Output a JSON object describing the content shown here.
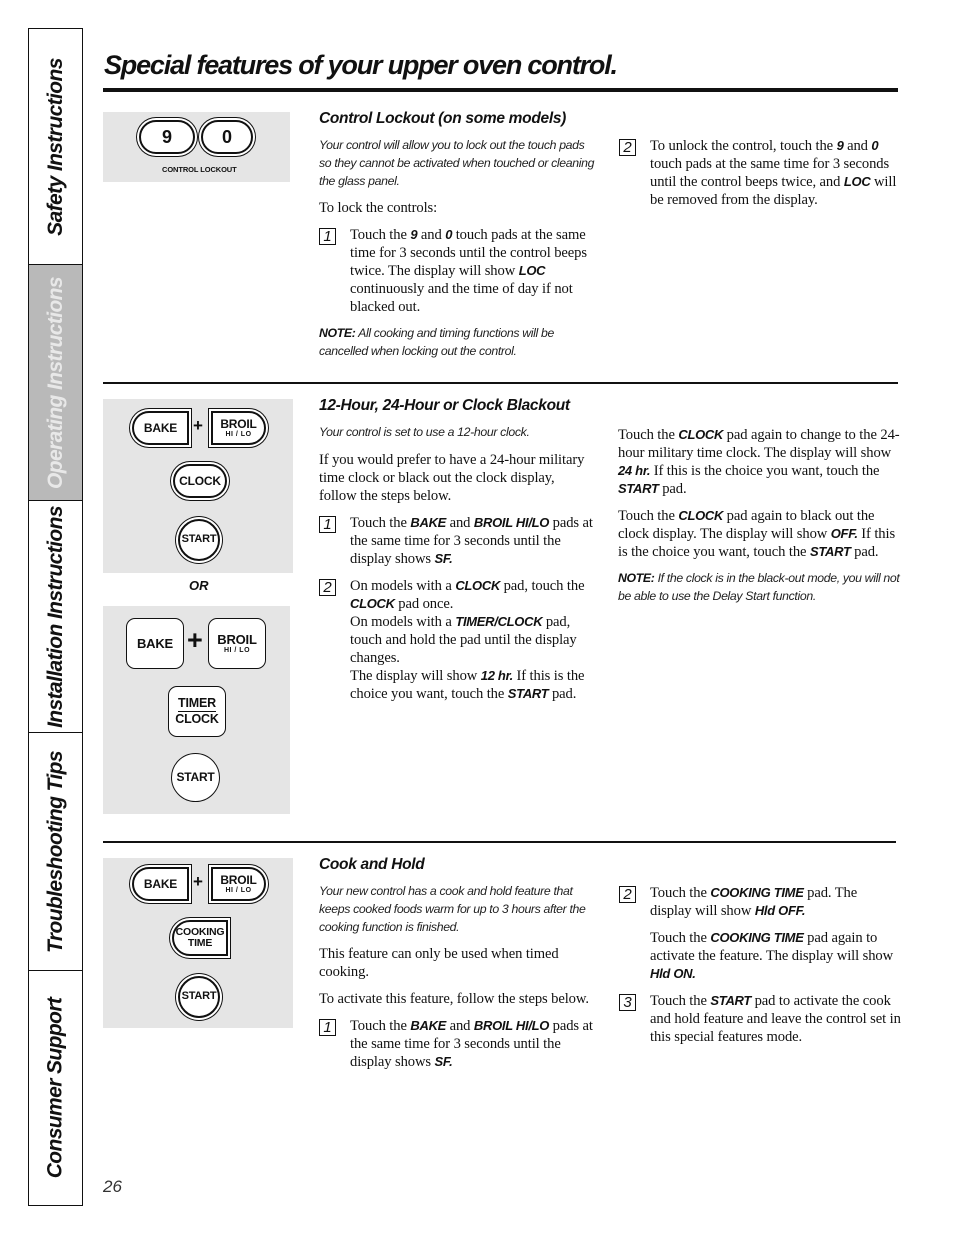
{
  "side_tabs": [
    {
      "label": "Safety Instructions",
      "active": false
    },
    {
      "label": "Operating Instructions",
      "active": true
    },
    {
      "label": "Installation Instructions",
      "active": false
    },
    {
      "label": "Troubleshooting Tips",
      "active": false
    },
    {
      "label": "Consumer Support",
      "active": false
    }
  ],
  "page_title": "Special features of your upper oven control.",
  "page_number": "26",
  "sections": {
    "lockout": {
      "heading": "Control Lockout (on some models)",
      "intro": "Your control will allow you to lock out the touch pads so they cannot be activated when touched or cleaning the glass panel.",
      "lead": "To lock the controls:",
      "pads": {
        "pad_9": "9",
        "pad_0": "0",
        "caption": "CONTROL LOCKOUT"
      },
      "step1": {
        "num": "1",
        "t1": "Touch the ",
        "k1": "9",
        "t2": " and ",
        "k2": "0",
        "t3": " touch pads at the same time for 3 seconds until the control beeps twice. The display will show ",
        "k3": "LOC",
        "t4": " continuously and the time of day if not blacked out."
      },
      "note": {
        "label": "NOTE:",
        "text": " All cooking and timing functions will be cancelled when locking out the control."
      },
      "step2": {
        "num": "2",
        "t1": "To unlock the control, touch the ",
        "k1": "9",
        "t2": " and ",
        "k2": "0",
        "t3": " touch pads at the same time for 3 seconds until the control beeps twice, and ",
        "k3": "LOC",
        "t4": " will be removed from the display."
      }
    },
    "clock": {
      "heading": "12-Hour, 24-Hour or Clock Blackout",
      "intro": "Your control is set to use a 12-hour clock.",
      "lead": "If you would prefer to have a 24-hour military time clock or black out the clock display, follow the steps below.",
      "panel_a": {
        "bake": "BAKE",
        "plus": "+",
        "broil": "BROIL",
        "broil_sub": "HI / LO",
        "clock": "CLOCK",
        "start": "START"
      },
      "or_label": "OR",
      "panel_b": {
        "bake": "BAKE",
        "plus": "+",
        "broil": "BROIL",
        "broil_sub": "HI / LO",
        "timer": "TIMER",
        "clock": "CLOCK",
        "start": "START"
      },
      "step1": {
        "num": "1",
        "t1": "Touch the ",
        "k1": "BAKE",
        "t2": " and ",
        "k2": "BROIL HI/LO",
        "t3": " pads at the same time for 3 seconds until the display shows ",
        "k3": "SF."
      },
      "step2": {
        "num": "2",
        "t1": "On models with a ",
        "k1": "CLOCK",
        "t2": " pad, touch the ",
        "k2": "CLOCK",
        "t3": " pad once.",
        "t4": "On models with a ",
        "k3": "TIMER/CLOCK",
        "t5": " pad, touch and hold the pad until the display changes.",
        "t6": "The display will show ",
        "k4": "12 hr.",
        "t7": " If this is the choice you want, touch the ",
        "k5": "START",
        "t8": " pad."
      },
      "para1": {
        "t1": "Touch the ",
        "k1": "CLOCK",
        "t2": " pad again to change to the 24-hour military time clock. The display will show ",
        "k2": "24 hr.",
        "t3": " If this is the choice you want, touch the ",
        "k3": "START",
        "t4": " pad."
      },
      "para2": {
        "t1": "Touch the ",
        "k1": "CLOCK",
        "t2": " pad again to black out the clock display. The display will show ",
        "k2": "OFF.",
        "t3": " If this is the choice you want, touch the ",
        "k3": "START",
        "t4": " pad."
      },
      "note": {
        "label": "NOTE:",
        "text": " If the clock is in the black-out mode, you will not be able to use the Delay Start function."
      }
    },
    "hold": {
      "heading": "Cook and Hold",
      "intro": "Your new control has a cook and hold feature that keeps cooked foods warm for up to 3 hours after the cooking function is finished.",
      "para1": "This feature can only be used when timed cooking.",
      "para2": "To activate this feature, follow the steps below.",
      "panel": {
        "bake": "BAKE",
        "plus": "+",
        "broil": "BROIL",
        "broil_sub": "HI / LO",
        "cooking": "COOKING",
        "time": "TIME",
        "start": "START"
      },
      "step1": {
        "num": "1",
        "t1": "Touch the ",
        "k1": "BAKE",
        "t2": " and ",
        "k2": "BROIL HI/LO",
        "t3": " pads at the same time for 3 seconds until the display shows ",
        "k3": "SF."
      },
      "step2": {
        "num": "2",
        "t1": "Touch the ",
        "k1": "COOKING TIME",
        "t2": " pad. The display will show ",
        "k2": "Hld OFF."
      },
      "step2b": {
        "t1": "Touch the ",
        "k1": "COOKING TIME",
        "t2": " pad again to activate the feature. The display will show ",
        "k2": "Hld ON."
      },
      "step3": {
        "num": "3",
        "t1": "Touch the ",
        "k1": "START",
        "t2": " pad to activate the cook and hold feature and leave the control set in this special features mode."
      }
    }
  }
}
